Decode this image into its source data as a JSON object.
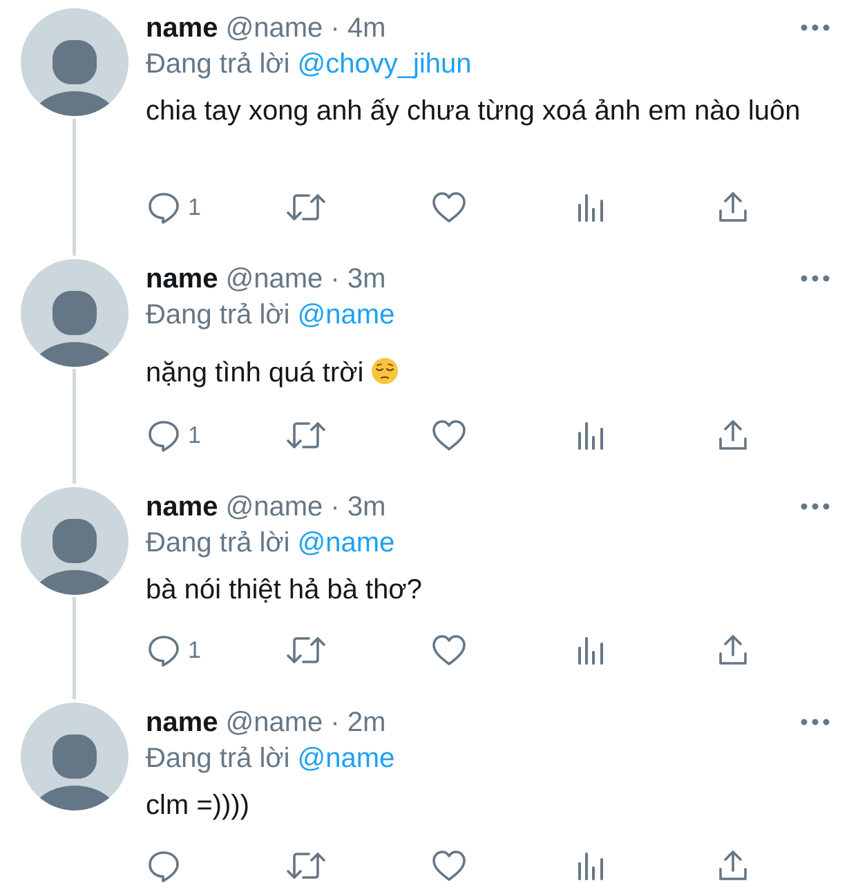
{
  "tweets": [
    {
      "name": "name",
      "handle": "@name",
      "separator": "·",
      "time": "4m",
      "reply_prefix": "Đang trả lời",
      "reply_to": "@chovy_jihun",
      "text": "chia tay xong anh ấy chưa từng xoá ảnh em nào luôn",
      "emoji": null,
      "reply_count": "1"
    },
    {
      "name": "name",
      "handle": "@name",
      "separator": "·",
      "time": "3m",
      "reply_prefix": "Đang trả lời",
      "reply_to": "@name",
      "text": "nặng tình quá trời",
      "emoji": "pensive-face",
      "reply_count": "1"
    },
    {
      "name": "name",
      "handle": "@name",
      "separator": "·",
      "time": "3m",
      "reply_prefix": "Đang trả lời",
      "reply_to": "@name",
      "text": "bà nói thiệt hả bà thơ?",
      "emoji": null,
      "reply_count": "1"
    },
    {
      "name": "name",
      "handle": "@name",
      "separator": "·",
      "time": "2m",
      "reply_prefix": "Đang trả lời",
      "reply_to": "@name",
      "text": "clm =))))",
      "emoji": null,
      "reply_count": ""
    }
  ],
  "icons": {
    "reply": "reply-icon",
    "retweet": "retweet-icon",
    "like": "like-icon",
    "analytics": "analytics-icon",
    "share": "share-icon",
    "more": "more-icon",
    "avatar": "default-avatar-icon"
  },
  "colors": {
    "text": "#14171a",
    "secondary": "#657786",
    "link": "#1da1f2",
    "icon": "#657786",
    "thread_line": "#cfd9de",
    "avatar_bg": "#ccd6dd",
    "avatar_fg": "#657786"
  }
}
